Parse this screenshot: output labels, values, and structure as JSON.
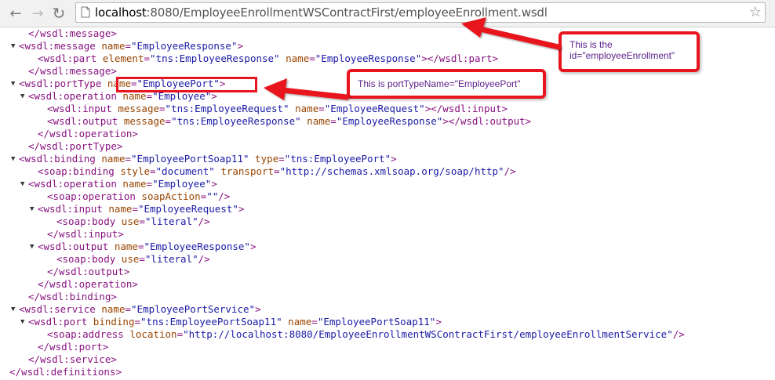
{
  "browser": {
    "url_host": "localhost",
    "url_rest": ":8080/EmployeeEnrollmentWSContractFirst/employeeEnrollment.wsdl"
  },
  "annotations": {
    "callout_id_line1": "This is the",
    "callout_id_line2": "id=\"employeeEnrollment\"",
    "callout_port": "This is portTypeName=\"EmployeePort\""
  },
  "wsdl_lines": [
    {
      "indent": 3,
      "toggle": "",
      "parts": [
        [
          "tag",
          "</wsdl:message>"
        ]
      ]
    },
    {
      "indent": 2,
      "toggle": "▼",
      "parts": [
        [
          "tag",
          "<wsdl:message"
        ],
        [
          "an",
          " name"
        ],
        [
          "tag",
          "="
        ],
        [
          "av",
          "\"EmployeeResponse\""
        ],
        [
          "tag",
          ">"
        ]
      ]
    },
    {
      "indent": 4,
      "toggle": "",
      "parts": [
        [
          "tag",
          "<wsdl:part"
        ],
        [
          "an",
          " element"
        ],
        [
          "tag",
          "="
        ],
        [
          "av",
          "\"tns:EmployeeResponse\""
        ],
        [
          "an",
          " name"
        ],
        [
          "tag",
          "="
        ],
        [
          "av",
          "\"EmployeeResponse\""
        ],
        [
          "tag",
          "></wsdl:part>"
        ]
      ]
    },
    {
      "indent": 3,
      "toggle": "",
      "parts": [
        [
          "tag",
          "</wsdl:message>"
        ]
      ]
    },
    {
      "indent": 2,
      "toggle": "▼",
      "parts": [
        [
          "tag",
          "<wsdl:portType"
        ],
        [
          "an",
          " name"
        ],
        [
          "tag",
          "="
        ],
        [
          "av",
          "\"EmployeePort\""
        ],
        [
          "tag",
          ">"
        ]
      ]
    },
    {
      "indent": 3,
      "toggle": "▼",
      "parts": [
        [
          "tag",
          "<wsdl:operation"
        ],
        [
          "an",
          " name"
        ],
        [
          "tag",
          "="
        ],
        [
          "av",
          "\"Employee\""
        ],
        [
          "tag",
          ">"
        ]
      ]
    },
    {
      "indent": 5,
      "toggle": "",
      "parts": [
        [
          "tag",
          "<wsdl:input"
        ],
        [
          "an",
          " message"
        ],
        [
          "tag",
          "="
        ],
        [
          "av",
          "\"tns:EmployeeRequest\""
        ],
        [
          "an",
          " name"
        ],
        [
          "tag",
          "="
        ],
        [
          "av",
          "\"EmployeeRequest\""
        ],
        [
          "tag",
          "></wsdl:input>"
        ]
      ]
    },
    {
      "indent": 5,
      "toggle": "",
      "parts": [
        [
          "tag",
          "<wsdl:output"
        ],
        [
          "an",
          " message"
        ],
        [
          "tag",
          "="
        ],
        [
          "av",
          "\"tns:EmployeeResponse\""
        ],
        [
          "an",
          " name"
        ],
        [
          "tag",
          "="
        ],
        [
          "av",
          "\"EmployeeResponse\""
        ],
        [
          "tag",
          "></wsdl:output>"
        ]
      ]
    },
    {
      "indent": 4,
      "toggle": "",
      "parts": [
        [
          "tag",
          "</wsdl:operation>"
        ]
      ]
    },
    {
      "indent": 3,
      "toggle": "",
      "parts": [
        [
          "tag",
          "</wsdl:portType>"
        ]
      ]
    },
    {
      "indent": 2,
      "toggle": "▼",
      "parts": [
        [
          "tag",
          "<wsdl:binding"
        ],
        [
          "an",
          " name"
        ],
        [
          "tag",
          "="
        ],
        [
          "av",
          "\"EmployeePortSoap11\""
        ],
        [
          "an",
          " type"
        ],
        [
          "tag",
          "="
        ],
        [
          "av",
          "\"tns:EmployeePort\""
        ],
        [
          "tag",
          ">"
        ]
      ]
    },
    {
      "indent": 4,
      "toggle": "",
      "parts": [
        [
          "tag",
          "<soap:binding"
        ],
        [
          "an",
          " style"
        ],
        [
          "tag",
          "="
        ],
        [
          "av",
          "\"document\""
        ],
        [
          "an",
          " transport"
        ],
        [
          "tag",
          "="
        ],
        [
          "av",
          "\"http://schemas.xmlsoap.org/soap/http\""
        ],
        [
          "tag",
          "/>"
        ]
      ]
    },
    {
      "indent": 3,
      "toggle": "▼",
      "parts": [
        [
          "tag",
          "<wsdl:operation"
        ],
        [
          "an",
          " name"
        ],
        [
          "tag",
          "="
        ],
        [
          "av",
          "\"Employee\""
        ],
        [
          "tag",
          ">"
        ]
      ]
    },
    {
      "indent": 5,
      "toggle": "",
      "parts": [
        [
          "tag",
          "<soap:operation"
        ],
        [
          "an",
          " soapAction"
        ],
        [
          "tag",
          "="
        ],
        [
          "av",
          "\"\""
        ],
        [
          "tag",
          "/>"
        ]
      ]
    },
    {
      "indent": 4,
      "toggle": "▼",
      "parts": [
        [
          "tag",
          "<wsdl:input"
        ],
        [
          "an",
          " name"
        ],
        [
          "tag",
          "="
        ],
        [
          "av",
          "\"EmployeeRequest\""
        ],
        [
          "tag",
          ">"
        ]
      ]
    },
    {
      "indent": 6,
      "toggle": "",
      "parts": [
        [
          "tag",
          "<soap:body"
        ],
        [
          "an",
          " use"
        ],
        [
          "tag",
          "="
        ],
        [
          "av",
          "\"literal\""
        ],
        [
          "tag",
          "/>"
        ]
      ]
    },
    {
      "indent": 5,
      "toggle": "",
      "parts": [
        [
          "tag",
          "</wsdl:input>"
        ]
      ]
    },
    {
      "indent": 4,
      "toggle": "▼",
      "parts": [
        [
          "tag",
          "<wsdl:output"
        ],
        [
          "an",
          " name"
        ],
        [
          "tag",
          "="
        ],
        [
          "av",
          "\"EmployeeResponse\""
        ],
        [
          "tag",
          ">"
        ]
      ]
    },
    {
      "indent": 6,
      "toggle": "",
      "parts": [
        [
          "tag",
          "<soap:body"
        ],
        [
          "an",
          " use"
        ],
        [
          "tag",
          "="
        ],
        [
          "av",
          "\"literal\""
        ],
        [
          "tag",
          "/>"
        ]
      ]
    },
    {
      "indent": 5,
      "toggle": "",
      "parts": [
        [
          "tag",
          "</wsdl:output>"
        ]
      ]
    },
    {
      "indent": 4,
      "toggle": "",
      "parts": [
        [
          "tag",
          "</wsdl:operation>"
        ]
      ]
    },
    {
      "indent": 3,
      "toggle": "",
      "parts": [
        [
          "tag",
          "</wsdl:binding>"
        ]
      ]
    },
    {
      "indent": 2,
      "toggle": "▼",
      "parts": [
        [
          "tag",
          "<wsdl:service"
        ],
        [
          "an",
          " name"
        ],
        [
          "tag",
          "="
        ],
        [
          "av",
          "\"EmployeePortService\""
        ],
        [
          "tag",
          ">"
        ]
      ]
    },
    {
      "indent": 3,
      "toggle": "▼",
      "parts": [
        [
          "tag",
          "<wsdl:port"
        ],
        [
          "an",
          " binding"
        ],
        [
          "tag",
          "="
        ],
        [
          "av",
          "\"tns:EmployeePortSoap11\""
        ],
        [
          "an",
          " name"
        ],
        [
          "tag",
          "="
        ],
        [
          "av",
          "\"EmployeePortSoap11\""
        ],
        [
          "tag",
          ">"
        ]
      ]
    },
    {
      "indent": 5,
      "toggle": "",
      "parts": [
        [
          "tag",
          "<soap:address"
        ],
        [
          "an",
          " location"
        ],
        [
          "tag",
          "="
        ],
        [
          "av",
          "\"http://localhost:8080/EmployeeEnrollmentWSContractFirst/employeeEnrollmentService\""
        ],
        [
          "tag",
          "/>"
        ]
      ]
    },
    {
      "indent": 4,
      "toggle": "",
      "parts": [
        [
          "tag",
          "</wsdl:port>"
        ]
      ]
    },
    {
      "indent": 3,
      "toggle": "",
      "parts": [
        [
          "tag",
          "</wsdl:service>"
        ]
      ]
    },
    {
      "indent": 1,
      "toggle": "",
      "parts": [
        [
          "tag",
          "</wsdl:definitions>"
        ]
      ]
    }
  ]
}
